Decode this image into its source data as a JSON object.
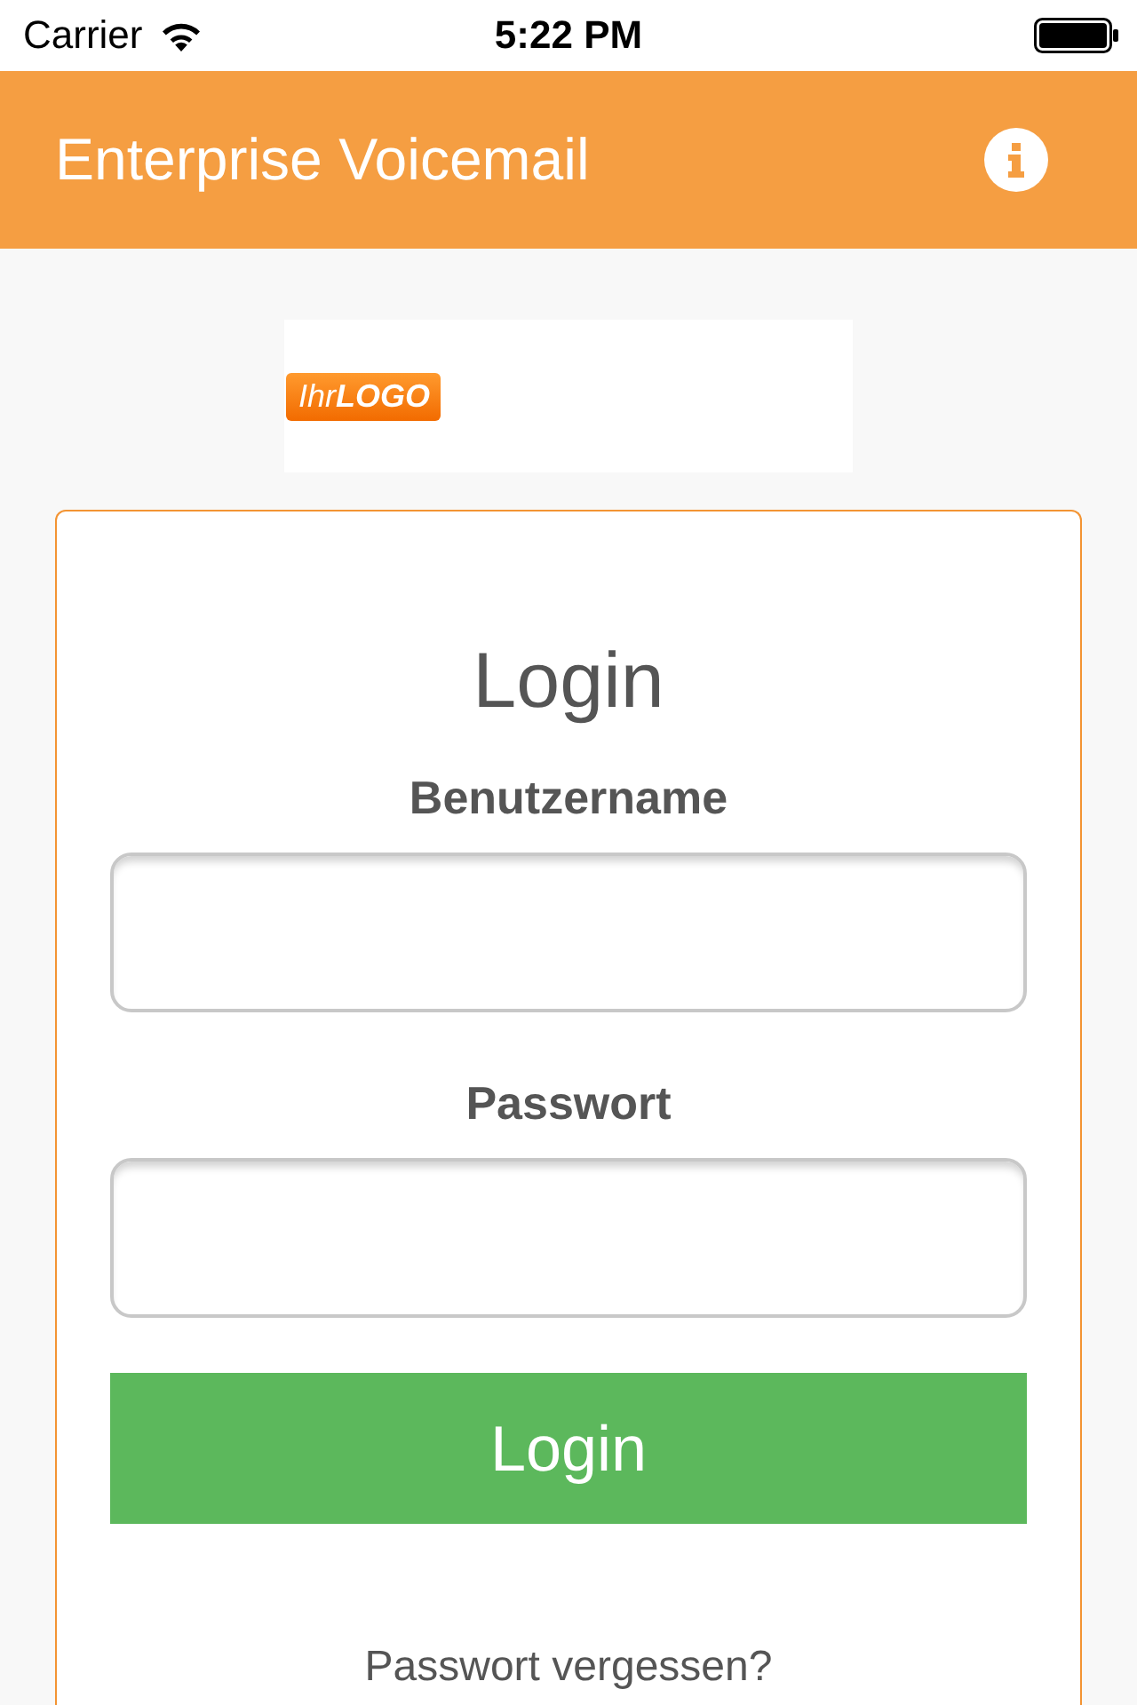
{
  "status_bar": {
    "carrier": "Carrier",
    "time": "5:22 PM"
  },
  "header": {
    "title": "Enterprise Voicemail"
  },
  "logo": {
    "text": "Ihr**LOGO**"
  },
  "login_form": {
    "title": "Login",
    "fields": [
      {
        "label": "Benutzername"
      },
      {
        "label": "Passwort"
      }
    ],
    "submit_button": "Login",
    "forgot_password_link": "Passwort vergessen?"
  }
}
